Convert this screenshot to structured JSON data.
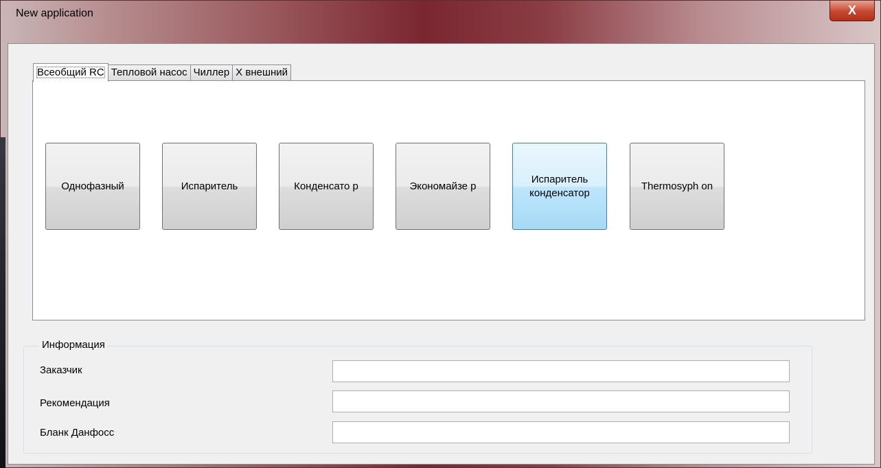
{
  "window": {
    "title": "New application",
    "close_label": "X"
  },
  "tabs": [
    {
      "label": "Всеобщий RC",
      "active": true
    },
    {
      "label": "Тепловой насос",
      "active": false
    },
    {
      "label": "Чиллер",
      "active": false
    },
    {
      "label": "Х внешний",
      "active": false
    }
  ],
  "tiles": [
    {
      "label": "Однофазный",
      "highlighted": false
    },
    {
      "label": "Испаритель",
      "highlighted": false
    },
    {
      "label": "Конденсато р",
      "highlighted": false
    },
    {
      "label": "Экономайзе р",
      "highlighted": false
    },
    {
      "label": "Испаритель конденсатор",
      "highlighted": true
    },
    {
      "label": "Thermosyph on",
      "highlighted": false
    }
  ],
  "info": {
    "title": "Информация",
    "fields": [
      {
        "label": "Заказчик",
        "value": ""
      },
      {
        "label": "Рекомендация",
        "value": ""
      },
      {
        "label": "Бланк Данфосс",
        "value": ""
      }
    ]
  }
}
